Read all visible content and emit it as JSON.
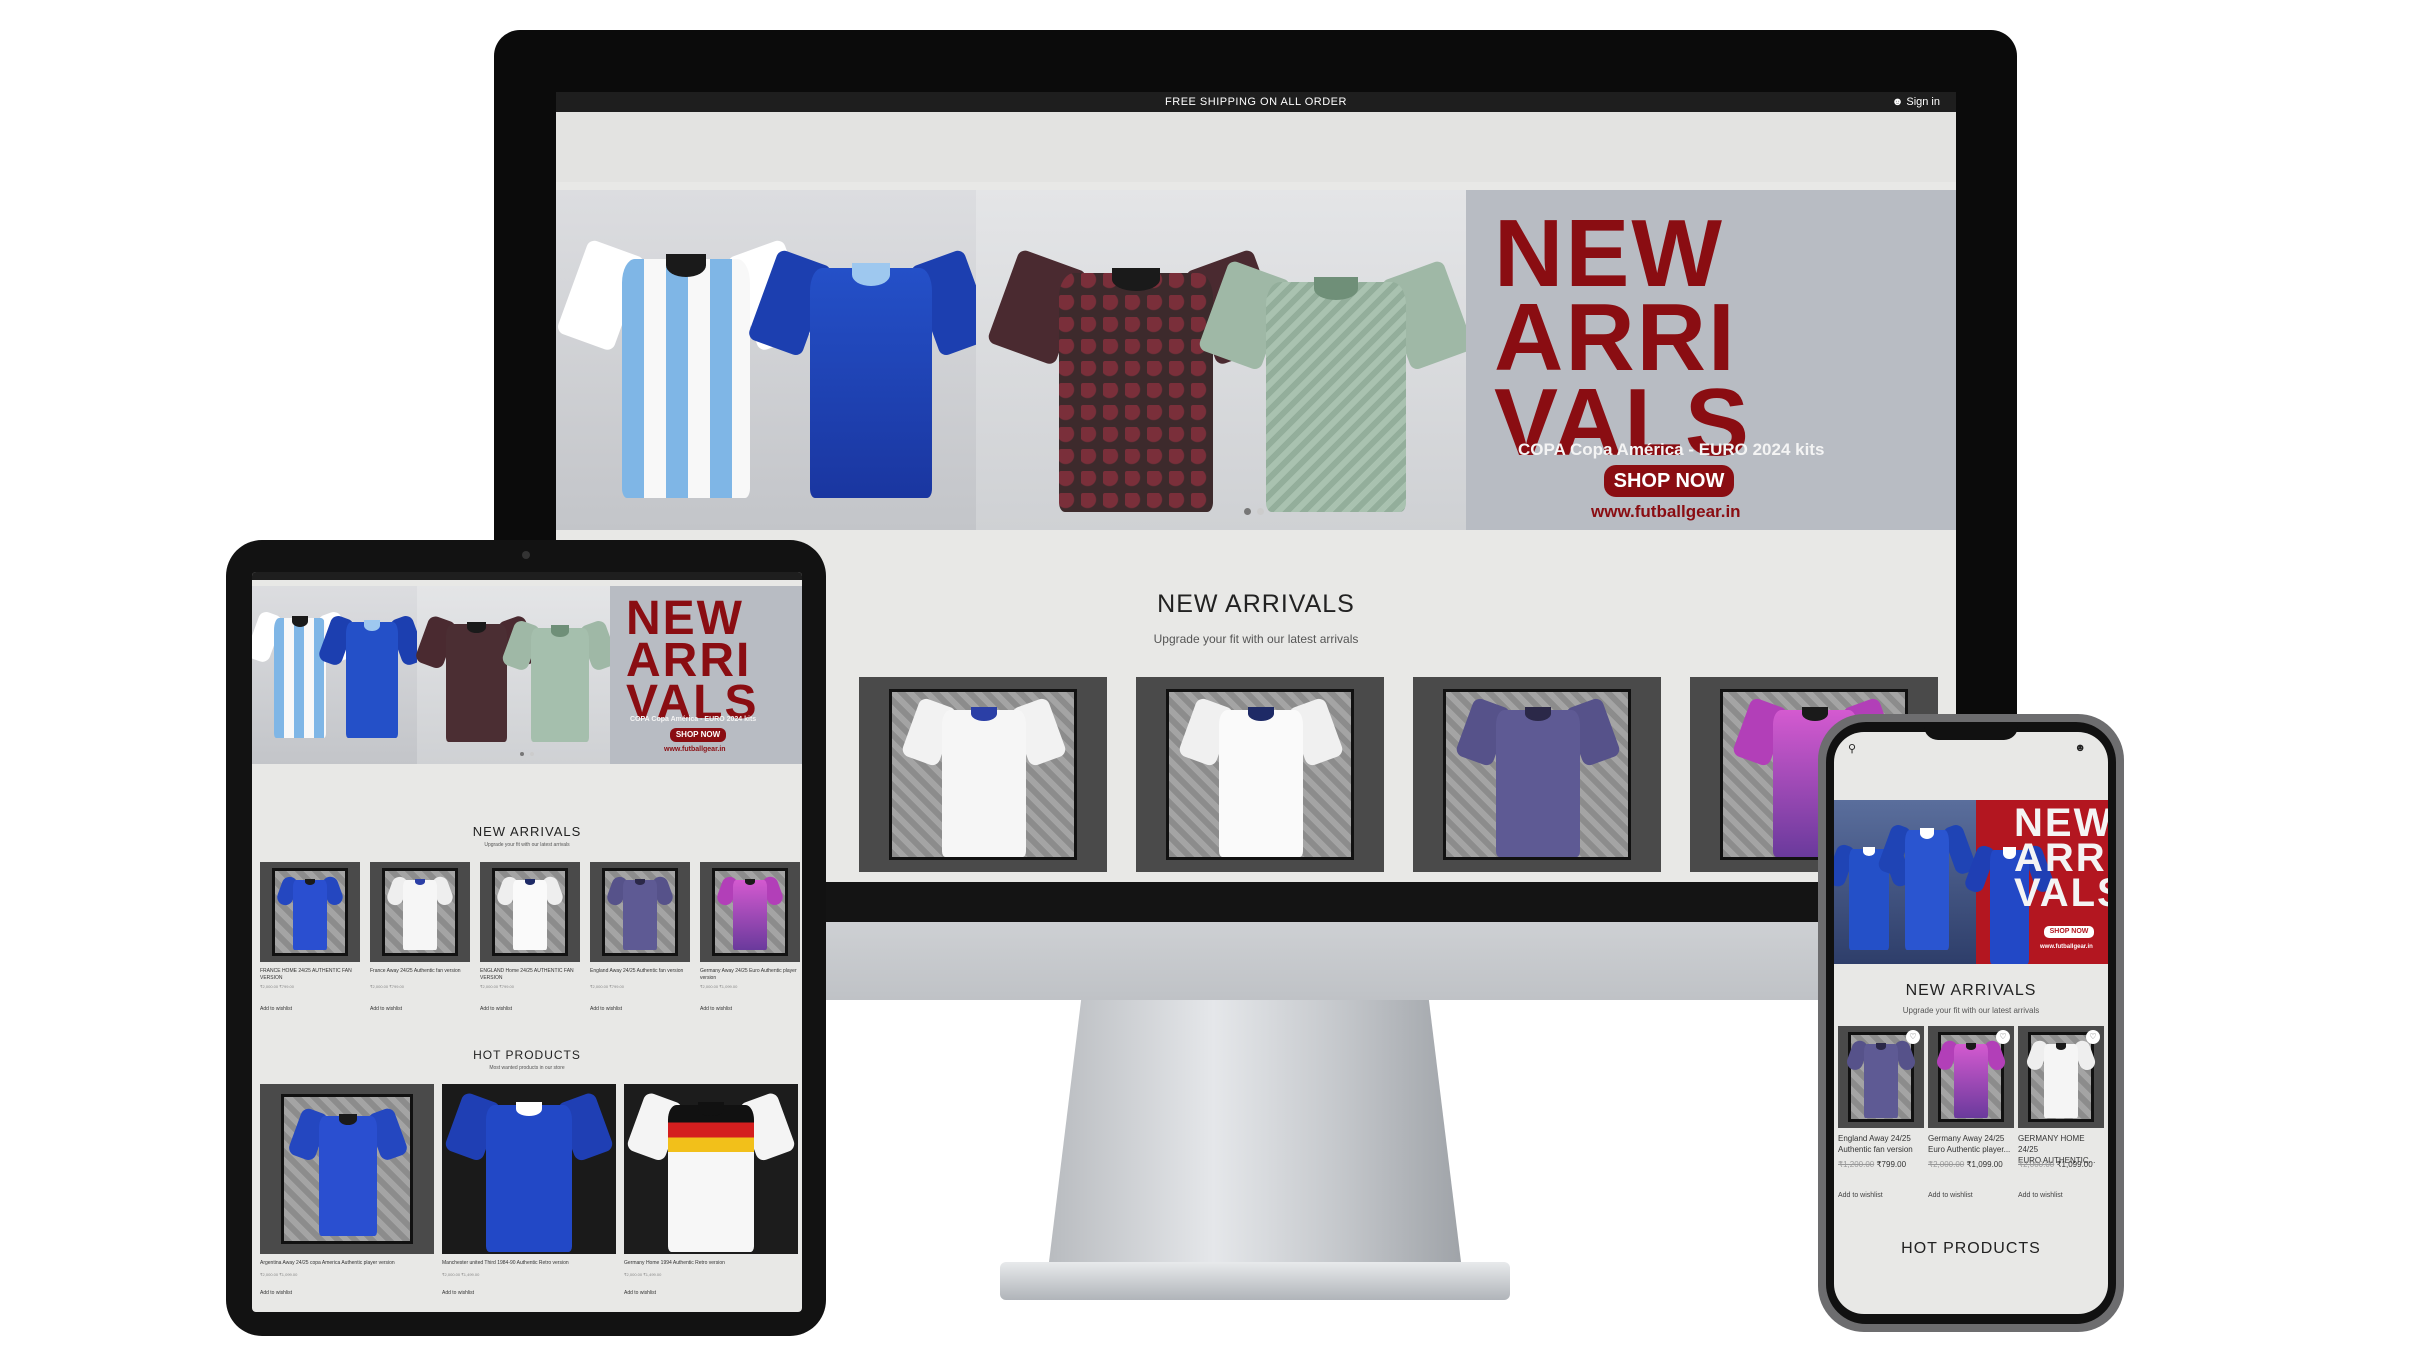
{
  "desktop": {
    "announcement": "FREE SHIPPING ON ALL ORDER",
    "sign_in": "Sign in",
    "banner": {
      "title_line1": "NEW",
      "title_line2": "ARRI",
      "title_line3": "VALS",
      "subtitle": "COPA Copa América - EURO 2024 kits",
      "button": "SHOP NOW",
      "url": "www.futballgear.in"
    },
    "new_arrivals": {
      "title": "NEW ARRIVALS",
      "subtitle": "Upgrade your fit with our latest arrivals"
    }
  },
  "tablet": {
    "banner": {
      "title_line1": "NEW",
      "title_line2": "ARRI",
      "title_line3": "VALS",
      "subtitle": "COPA Copa América - EURO 2024 kits",
      "button": "SHOP NOW",
      "url": "www.futballgear.in"
    },
    "new_arrivals": {
      "title": "NEW ARRIVALS",
      "subtitle": "Upgrade your fit with our latest arrivals",
      "products": [
        {
          "name": "FRANCE HOME 24/25 AUTHENTIC FAN VERSION",
          "price": "₹2,000.00 ₹799.00",
          "wishlist": "Add to wishlist"
        },
        {
          "name": "France Away 24/25 Authentic fan version",
          "price": "₹2,000.00 ₹799.00",
          "wishlist": "Add to wishlist"
        },
        {
          "name": "ENGLAND Home 24/25 AUTHENTIC FAN VERSION",
          "price": "₹2,000.00 ₹799.00",
          "wishlist": "Add to wishlist"
        },
        {
          "name": "England Away 24/25 Authentic fan version",
          "price": "₹2,000.00 ₹799.00",
          "wishlist": "Add to wishlist"
        },
        {
          "name": "Germany Away 24/25 Euro Authentic player version",
          "price": "₹2,000.00 ₹1,099.00",
          "wishlist": "Add to wishlist"
        }
      ]
    },
    "hot_products": {
      "title": "HOT PRODUCTS",
      "subtitle": "Most wanted products in our store",
      "products": [
        {
          "name": "Argentina Away 24/25 copa America Authentic player version",
          "price": "₹2,000.00 ₹1,099.00",
          "wishlist": "Add to wishlist"
        },
        {
          "name": "Manchester united Third 1984-90 Authentic Retro version",
          "price": "₹2,000.00 ₹1,499.00",
          "wishlist": "Add to wishlist"
        },
        {
          "name": "Germany Home 1994 Authentic Retro version",
          "price": "₹2,000.00 ₹1,499.00",
          "wishlist": "Add to wishlist"
        }
      ]
    }
  },
  "phone": {
    "banner": {
      "title_line1": "NEW",
      "title_line2": "ARRI",
      "title_line3": "VALS",
      "button": "SHOP NOW",
      "url": "www.futballgear.in"
    },
    "new_arrivals": {
      "title": "NEW ARRIVALS",
      "subtitle": "Upgrade your fit with our latest arrivals",
      "products": [
        {
          "name_line1": "England Away 24/25",
          "name_line2": "Authentic fan version",
          "old_price": "₹1,200.00",
          "price": "₹799.00",
          "wishlist": "Add to wishlist"
        },
        {
          "name_line1": "Germany Away 24/25",
          "name_line2": "Euro Authentic player...",
          "old_price": "₹2,000.00",
          "price": "₹1,099.00",
          "wishlist": "Add to wishlist"
        },
        {
          "name_line1": "GERMANY HOME 24/25",
          "name_line2": "EURO AUTHENTIC...",
          "old_price": "₹2,000.00",
          "price": "₹1,099.00",
          "wishlist": "Add to wishlist"
        }
      ]
    },
    "hot_products": {
      "title": "HOT PRODUCTS"
    }
  },
  "icons": [
    "user-icon",
    "search-icon",
    "heart-icon",
    "camera-icon"
  ],
  "colors": {
    "brand_red": "#8a0d12",
    "banner_gray": "#b8bcc3",
    "page_bg": "#e8e8e6",
    "topbar": "#1e1e1e"
  }
}
